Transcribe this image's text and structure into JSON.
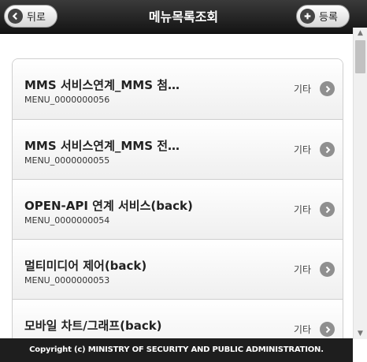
{
  "header": {
    "title": "메뉴목록조회",
    "back_label": "뒤로",
    "add_label": "등록"
  },
  "menu_items": [
    {
      "title": "MMS 서비스연계_MMS 첨…",
      "code": "MENU_0000000056",
      "category": "기타"
    },
    {
      "title": "MMS 서비스연계_MMS 전…",
      "code": "MENU_0000000055",
      "category": "기타"
    },
    {
      "title": "OPEN-API 연계 서비스(back)",
      "code": "MENU_0000000054",
      "category": "기타"
    },
    {
      "title": "멀티미디어 제어(back)",
      "code": "MENU_0000000053",
      "category": "기타"
    },
    {
      "title": "모바일 차트/그래프(back)",
      "code": "",
      "category": "기타"
    }
  ],
  "footer": {
    "copyright": "Copyright (c) MINISTRY OF SECURITY AND PUBLIC ADMINISTRATION."
  }
}
